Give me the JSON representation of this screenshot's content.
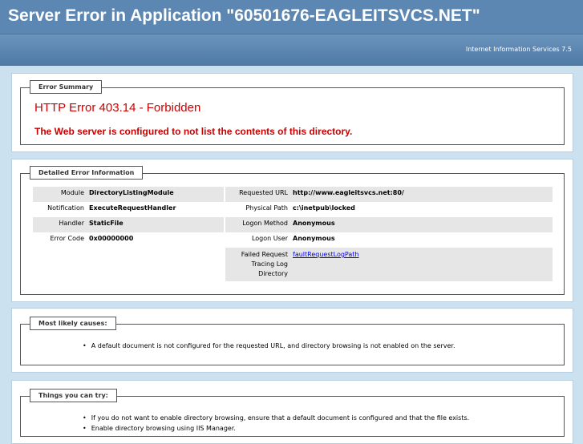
{
  "header": {
    "title": "Server Error in Application \"60501676-EAGLEITSVCS.NET\"",
    "product": "Internet Information Services 7.5"
  },
  "summary": {
    "legend": "Error Summary",
    "title": "HTTP Error 403.14 - Forbidden",
    "description": "The Web server is configured to not list the contents of this directory."
  },
  "details": {
    "legend": "Detailed Error Information",
    "left": [
      {
        "label": "Module",
        "value": "DirectoryListingModule"
      },
      {
        "label": "Notification",
        "value": "ExecuteRequestHandler"
      },
      {
        "label": "Handler",
        "value": "StaticFile"
      },
      {
        "label": "Error Code",
        "value": "0x00000000"
      }
    ],
    "right": [
      {
        "label": "Requested URL",
        "value": "http://www.eagleitsvcs.net:80/"
      },
      {
        "label": "Physical Path",
        "value": "c:\\inetpub\\locked"
      },
      {
        "label": "Logon Method",
        "value": "Anonymous"
      },
      {
        "label": "Logon User",
        "value": "Anonymous"
      },
      {
        "label": "Failed Request Tracing Log Directory",
        "value": "faultRequestLogPath"
      }
    ]
  },
  "causes": {
    "legend": "Most likely causes:",
    "items": [
      "A default document is not configured for the requested URL, and directory browsing is not enabled on the server."
    ]
  },
  "try": {
    "legend": "Things you can try:",
    "items": [
      "If you do not want to enable directory browsing, ensure that a default document is configured and that the file exists.",
      "Enable directory browsing using IIS Manager."
    ]
  }
}
